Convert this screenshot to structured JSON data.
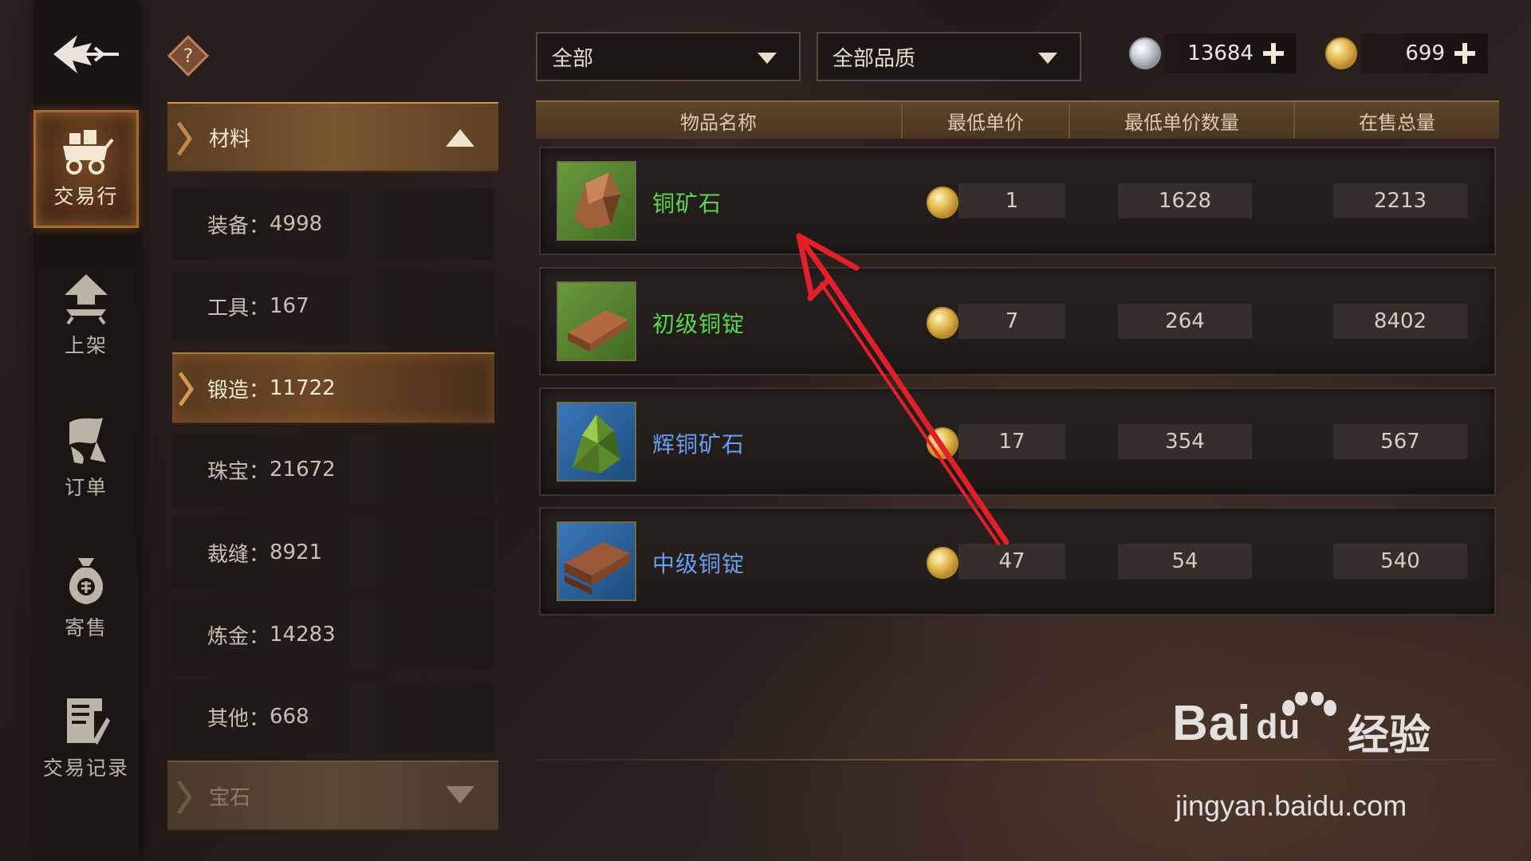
{
  "nav": {
    "items": [
      {
        "label": "交易行",
        "icon": "merchant-cart-icon",
        "active": true
      },
      {
        "label": "上架",
        "icon": "upload-arrow-icon",
        "active": false
      },
      {
        "label": "订单",
        "icon": "order-scroll-icon",
        "active": false
      },
      {
        "label": "寄售",
        "icon": "money-bag-icon",
        "active": false
      },
      {
        "label": "交易记录",
        "icon": "record-book-icon",
        "active": false
      }
    ]
  },
  "categories": {
    "expanded": {
      "label": "材料"
    },
    "sub_items": [
      {
        "label": "装备：",
        "count": "4998"
      },
      {
        "label": "工具：",
        "count": "167"
      },
      {
        "label": "锻造：",
        "count": "11722",
        "active": true
      },
      {
        "label": "珠宝：",
        "count": "21672"
      },
      {
        "label": "裁缝：",
        "count": "8921"
      },
      {
        "label": "炼金：",
        "count": "14283"
      },
      {
        "label": "其他：",
        "count": "668"
      }
    ],
    "collapsed": {
      "label": "宝石"
    }
  },
  "filters": {
    "type_selected": "全部",
    "quality_selected": "全部品质"
  },
  "currency": {
    "silver": "13684",
    "gold": "699"
  },
  "table": {
    "headers": [
      "物品名称",
      "最低单价",
      "最低单价数量",
      "在售总量"
    ],
    "rows": [
      {
        "name": "铜矿石",
        "rarity_color": "#5cd64a",
        "price": "1",
        "qty": "1628",
        "total": "2213"
      },
      {
        "name": "初级铜锭",
        "rarity_color": "#5cd64a",
        "price": "7",
        "qty": "264",
        "total": "8402"
      },
      {
        "name": "辉铜矿石",
        "rarity_color": "#6a9ef2",
        "price": "17",
        "qty": "354",
        "total": "567"
      },
      {
        "name": "中级铜锭",
        "rarity_color": "#6a9ef2",
        "price": "47",
        "qty": "54",
        "total": "540"
      }
    ]
  },
  "watermark": {
    "brand": "Bai",
    "brand_du": "du",
    "brand_suffix": "经验",
    "url": "jingyan.baidu.com"
  },
  "colors": {
    "accent_gold": "#a86a31",
    "rarity_green": "#5cd64a",
    "rarity_blue": "#6a9ef2",
    "annotation_red": "#e3202a"
  }
}
